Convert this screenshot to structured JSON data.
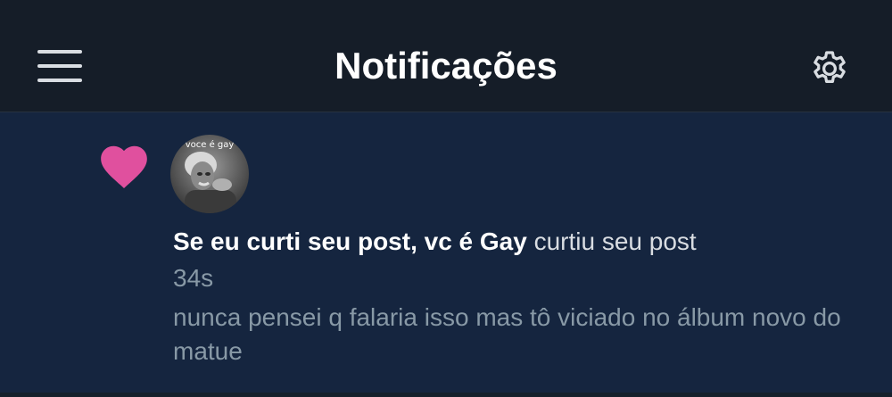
{
  "header": {
    "title": "Notificações",
    "menu_icon": "hamburger-menu-icon",
    "settings_icon": "gear-icon"
  },
  "notification": {
    "type_icon": "heart-icon",
    "avatar_caption": "voce é gay",
    "user_name": "Se eu curti seu post, vc é Gay",
    "action": "curtiu seu post",
    "time": "34s",
    "post_preview": "nunca pensei q falaria isso mas tô viciado no álbum novo do matue"
  },
  "colors": {
    "header_bg": "#151d28",
    "notification_bg": "#15253f",
    "heart": "#e0509e",
    "muted_text": "#8899a6",
    "title_text": "#ffffff"
  }
}
